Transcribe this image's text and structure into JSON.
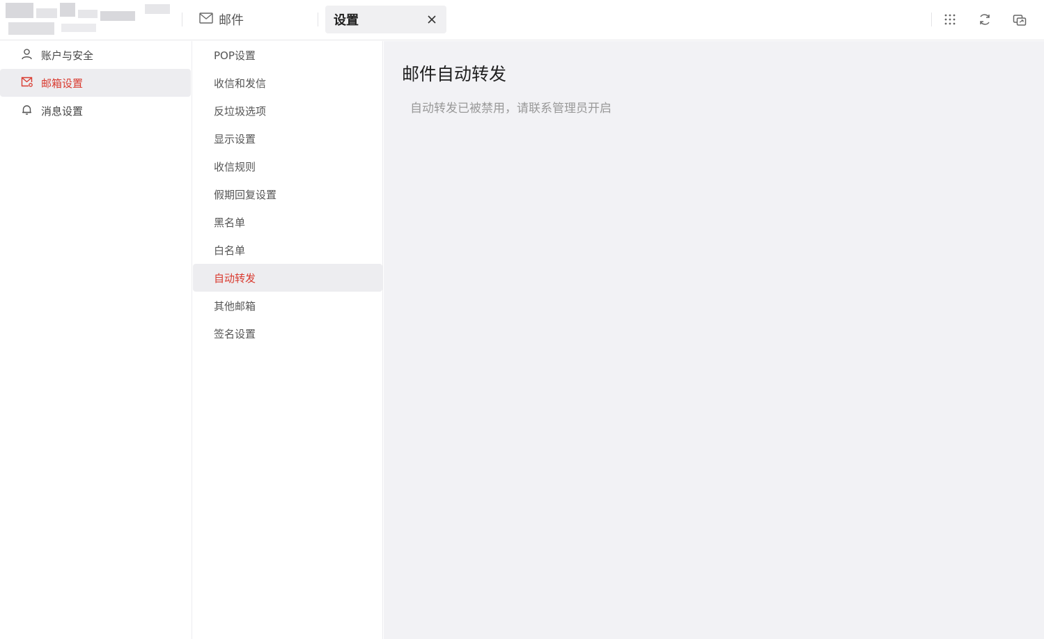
{
  "header": {
    "mail_tab_label": "邮件",
    "settings_tab_label": "设置"
  },
  "sidebar_primary": {
    "items": [
      {
        "label": "账户与安全",
        "icon": "user-icon"
      },
      {
        "label": "邮箱设置",
        "icon": "mail-settings-icon",
        "active": true
      },
      {
        "label": "消息设置",
        "icon": "bell-icon"
      }
    ]
  },
  "sidebar_secondary": {
    "items": [
      {
        "label": "POP设置"
      },
      {
        "label": "收信和发信"
      },
      {
        "label": "反垃圾选项"
      },
      {
        "label": "显示设置"
      },
      {
        "label": "收信规则"
      },
      {
        "label": "假期回复设置"
      },
      {
        "label": "黑名单"
      },
      {
        "label": "白名单"
      },
      {
        "label": "自动转发",
        "active": true
      },
      {
        "label": "其他邮箱"
      },
      {
        "label": "签名设置"
      }
    ]
  },
  "main": {
    "title": "邮件自动转发",
    "notice": "自动转发已被禁用，请联系管理员开启"
  },
  "colors": {
    "accent": "#d93a2f",
    "active_bg": "#ededf0",
    "content_bg": "#f2f2f5"
  }
}
